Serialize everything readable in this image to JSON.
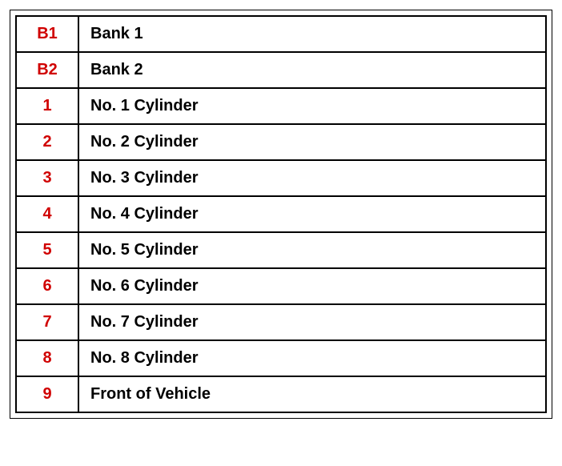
{
  "legend": {
    "rows": [
      {
        "code": "B1",
        "description": "Bank 1"
      },
      {
        "code": "B2",
        "description": "Bank 2"
      },
      {
        "code": "1",
        "description": "No. 1 Cylinder"
      },
      {
        "code": "2",
        "description": "No. 2 Cylinder"
      },
      {
        "code": "3",
        "description": "No. 3 Cylinder"
      },
      {
        "code": "4",
        "description": "No. 4 Cylinder"
      },
      {
        "code": "5",
        "description": "No. 5 Cylinder"
      },
      {
        "code": "6",
        "description": "No. 6 Cylinder"
      },
      {
        "code": "7",
        "description": "No. 7 Cylinder"
      },
      {
        "code": "8",
        "description": "No. 8 Cylinder"
      },
      {
        "code": "9",
        "description": "Front of Vehicle"
      }
    ]
  }
}
